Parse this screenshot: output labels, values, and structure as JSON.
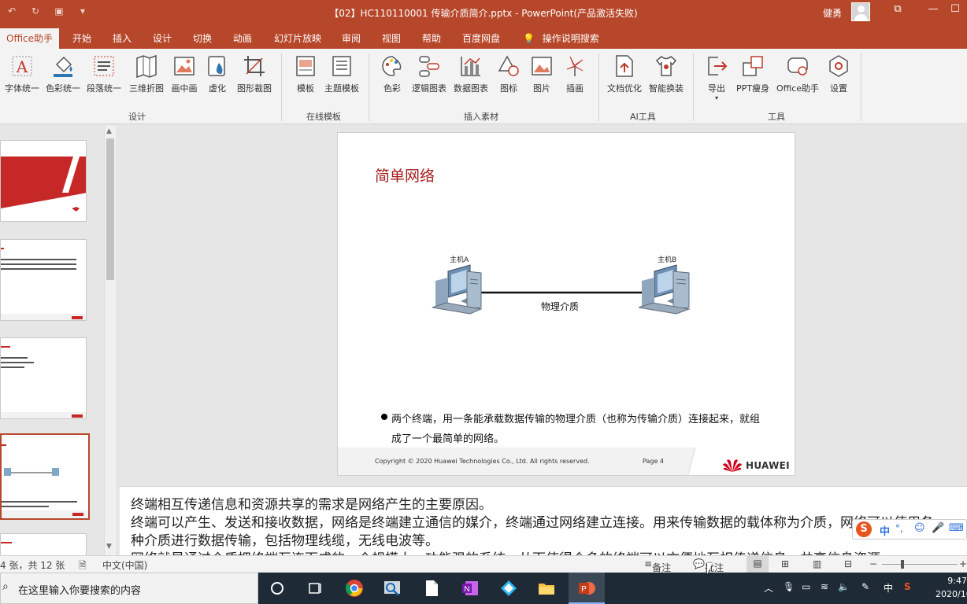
{
  "window": {
    "title": "【02】HC110110001 传输介质简介.pptx - PowerPoint(产品激活失败)",
    "user": "健勇",
    "controls": [
      "restore-ribbon",
      "minimize",
      "maximize",
      "close"
    ]
  },
  "tabs": [
    {
      "label": "Office助手",
      "active": true
    },
    {
      "label": "开始"
    },
    {
      "label": "插入"
    },
    {
      "label": "设计"
    },
    {
      "label": "切换"
    },
    {
      "label": "动画"
    },
    {
      "label": "幻灯片放映"
    },
    {
      "label": "审阅"
    },
    {
      "label": "视图"
    },
    {
      "label": "帮助"
    },
    {
      "label": "百度网盘"
    },
    {
      "label": "操作说明搜索"
    }
  ],
  "ribbon": {
    "groups": [
      {
        "label": "设计",
        "items": [
          {
            "label": "字体统一",
            "icon": "font-icon"
          },
          {
            "label": "色彩统一",
            "icon": "paint-bucket-icon"
          },
          {
            "label": "段落统一",
            "icon": "paragraph-icon"
          },
          {
            "label": "三维折图",
            "icon": "map-fold-icon"
          },
          {
            "label": "画中画",
            "icon": "picture-icon"
          },
          {
            "label": "虚化",
            "icon": "blur-drop-icon"
          },
          {
            "label": "图形裁图",
            "icon": "crop-icon"
          }
        ]
      },
      {
        "label": "在线模板",
        "items": [
          {
            "label": "模板",
            "icon": "template-icon"
          },
          {
            "label": "主题模板",
            "icon": "theme-template-icon"
          }
        ]
      },
      {
        "label": "插入素材",
        "items": [
          {
            "label": "色彩",
            "icon": "palette-icon"
          },
          {
            "label": "逻辑图表",
            "icon": "logic-chart-icon"
          },
          {
            "label": "数据图表",
            "icon": "data-chart-icon"
          },
          {
            "label": "图标",
            "icon": "shapes-icon"
          },
          {
            "label": "图片",
            "icon": "image-icon"
          },
          {
            "label": "插画",
            "icon": "illustration-icon"
          }
        ]
      },
      {
        "label": "AI工具",
        "items": [
          {
            "label": "文档优化",
            "icon": "doc-optimize-icon"
          },
          {
            "label": "智能换装",
            "icon": "shirt-icon"
          }
        ]
      },
      {
        "label": "工具",
        "items": [
          {
            "label": "导出",
            "icon": "export-icon"
          },
          {
            "label": "PPT瘦身",
            "icon": "slim-icon"
          },
          {
            "label": "Office助手",
            "icon": "assistant-icon"
          },
          {
            "label": "设置",
            "icon": "settings-icon"
          }
        ]
      }
    ]
  },
  "thumbnails": [
    {
      "title": "",
      "selected": false
    },
    {
      "title": "",
      "selected": false
    },
    {
      "title": "",
      "selected": false
    },
    {
      "title": "",
      "selected": true
    },
    {
      "title": "",
      "selected": false
    }
  ],
  "slide": {
    "title": "简单网络",
    "host_a": "主机A",
    "host_b": "主机B",
    "medium": "物理介质",
    "bullet": "两个终端，用一条能承载数据传输的物理介质（也称为传输介质）连接起来，就组成了一个最简单的网络。",
    "copyright": "Copyright © 2020 Huawei Technologies Co., Ltd. All rights reserved.",
    "page": "Page 4",
    "brand": "HUAWEI"
  },
  "notes": [
    "终端相互传递信息和资源共享的需求是网络产生的主要原因。",
    "终端可以产生、发送和接收数据，网络是终端建立通信的媒介，终端通过网络建立连接。用来传输数据的载体称为介质，网络可以使用各",
    "种介质进行数据传输，包括物理线缆，无线电波等。",
    "网络就是通过介质把终端互连而成的一个规模大，功能强的系统，从而使得众多的终端可以方便地互相传递信息，共享信息资源。"
  ],
  "status": {
    "slide_count": "4 张，共 12 张",
    "language": "中文(中国)",
    "notes_btn": "备注",
    "comments_btn": "批注"
  },
  "taskbar": {
    "search_placeholder": "在这里输入你要搜索的内容",
    "time": "9:47",
    "date": "2020/10/",
    "ime": "中"
  },
  "colors": {
    "accent": "#b7472a",
    "slide_title": "#a31e1e",
    "taskbar": "#1e2a36"
  }
}
